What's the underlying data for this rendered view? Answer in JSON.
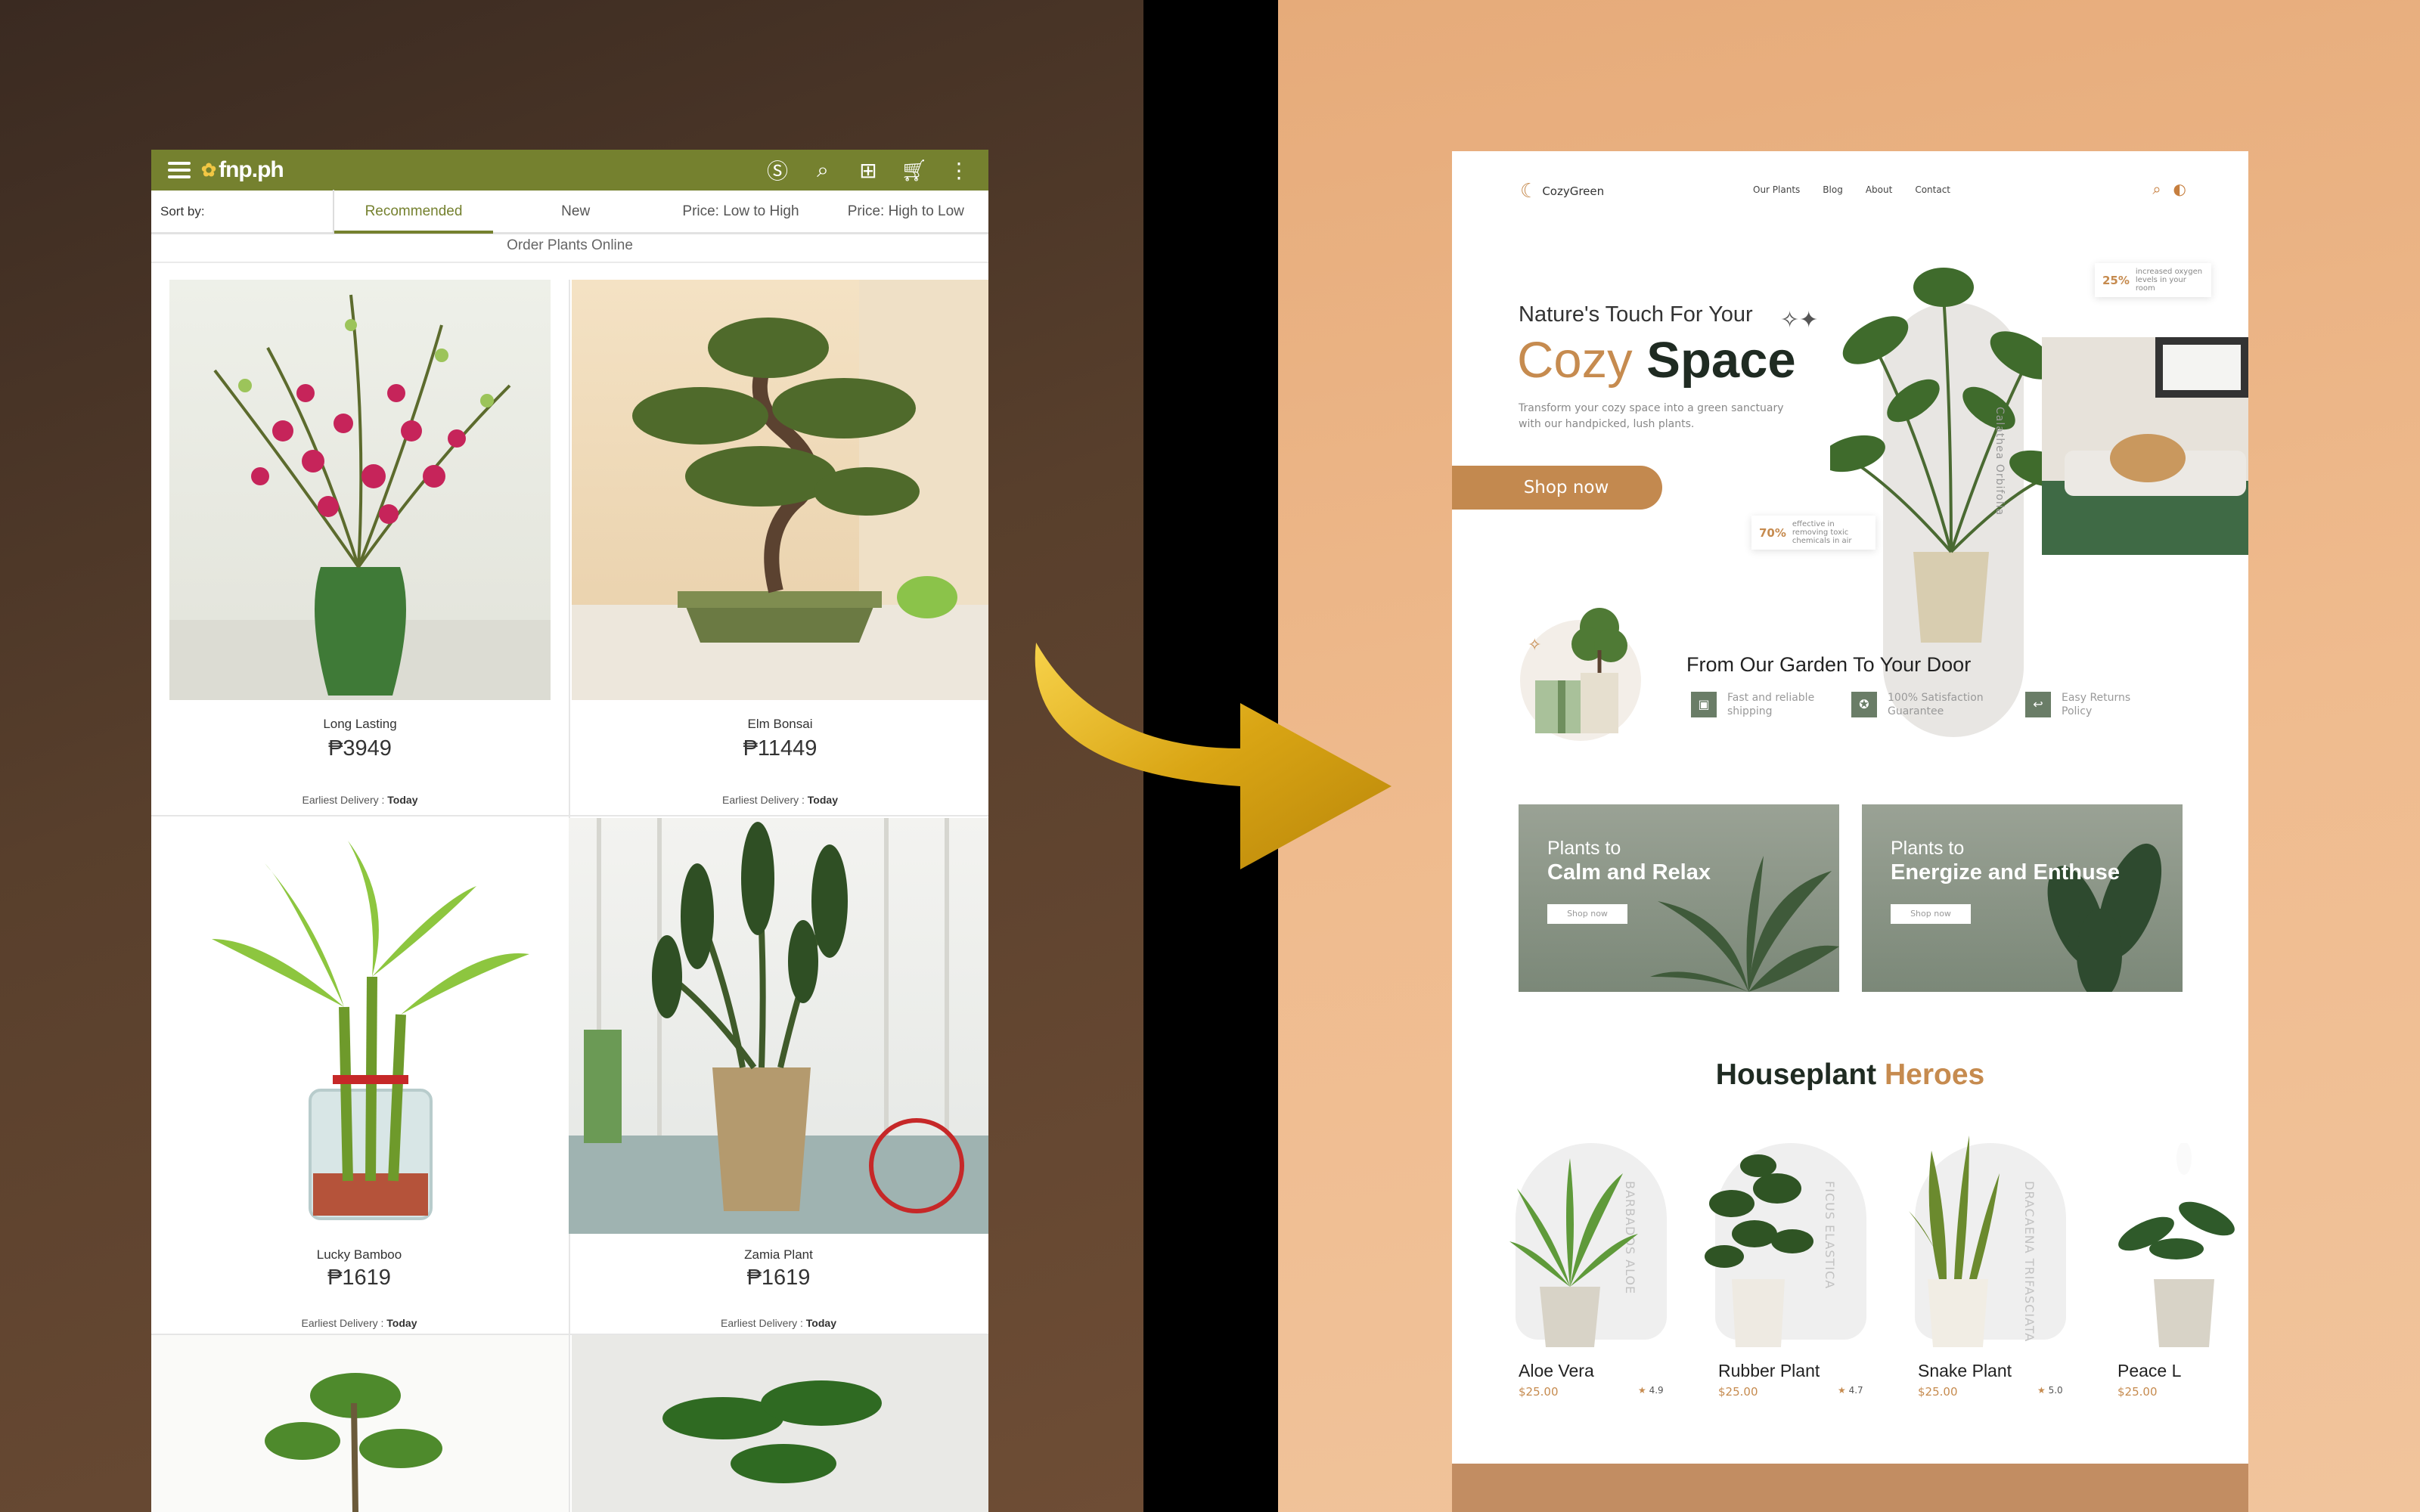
{
  "fnp": {
    "brand": "fnp.ph",
    "sort_label": "Sort by:",
    "sort_options": [
      "Recommended",
      "New",
      "Price: Low to High",
      "Price: High to Low"
    ],
    "active_sort": "Recommended",
    "subtitle": "Order Plants Online",
    "delivery_label": "Earliest Delivery : ",
    "delivery_value": "Today",
    "products": [
      {
        "name": "Long Lasting",
        "price": "₱3949"
      },
      {
        "name": "Elm Bonsai",
        "price": "₱11449"
      },
      {
        "name": "Lucky Bamboo",
        "price": "₱1619"
      },
      {
        "name": "Zamia Plant",
        "price": "₱1619"
      }
    ],
    "colors": {
      "bar": "#75812f"
    }
  },
  "cozy": {
    "brand": "CozyGreen",
    "nav": [
      "Our Plants",
      "Blog",
      "About",
      "Contact"
    ],
    "hero_sub": "Nature's Touch For Your",
    "hero_word1": "Cozy",
    "hero_word2": "Space",
    "hero_desc": "Transform your cozy space into a green sanctuary with our handpicked, lush plants.",
    "cta": "Shop now",
    "stat1_value": "25%",
    "stat1_text": "increased oxygen levels in your room",
    "stat2_value": "70%",
    "stat2_text": "effective in removing toxic chemicals in air",
    "vertical_label": "Calathea Orbifolia",
    "garden_title": "From Our Garden To Your Door",
    "features": [
      "Fast and reliable shipping",
      "100% Satisfaction Guarantee",
      "Easy Returns Policy"
    ],
    "promos": [
      {
        "line1": "Plants to",
        "line2": "Calm and Relax",
        "button": "Shop now"
      },
      {
        "line1": "Plants to",
        "line2": "Energize and Enthuse",
        "button": "Shop now"
      }
    ],
    "section_title_a": "Houseplant",
    "section_title_b": "Heroes",
    "plants": [
      {
        "name": "Aloe Vera",
        "price": "$25.00",
        "rating": "4.9",
        "latin": "BARBADOS ALOE"
      },
      {
        "name": "Rubber Plant",
        "price": "$25.00",
        "rating": "4.7",
        "latin": "FICUS ELASTICA"
      },
      {
        "name": "Snake Plant",
        "price": "$25.00",
        "rating": "5.0",
        "latin": "DRACAENA TRIFASCIATA"
      },
      {
        "name": "Peace L",
        "price": "$25.00",
        "rating": "",
        "latin": ""
      }
    ],
    "colors": {
      "accent": "#c68b4f",
      "dark": "#1f2b22",
      "sage": "#7b8878"
    }
  }
}
